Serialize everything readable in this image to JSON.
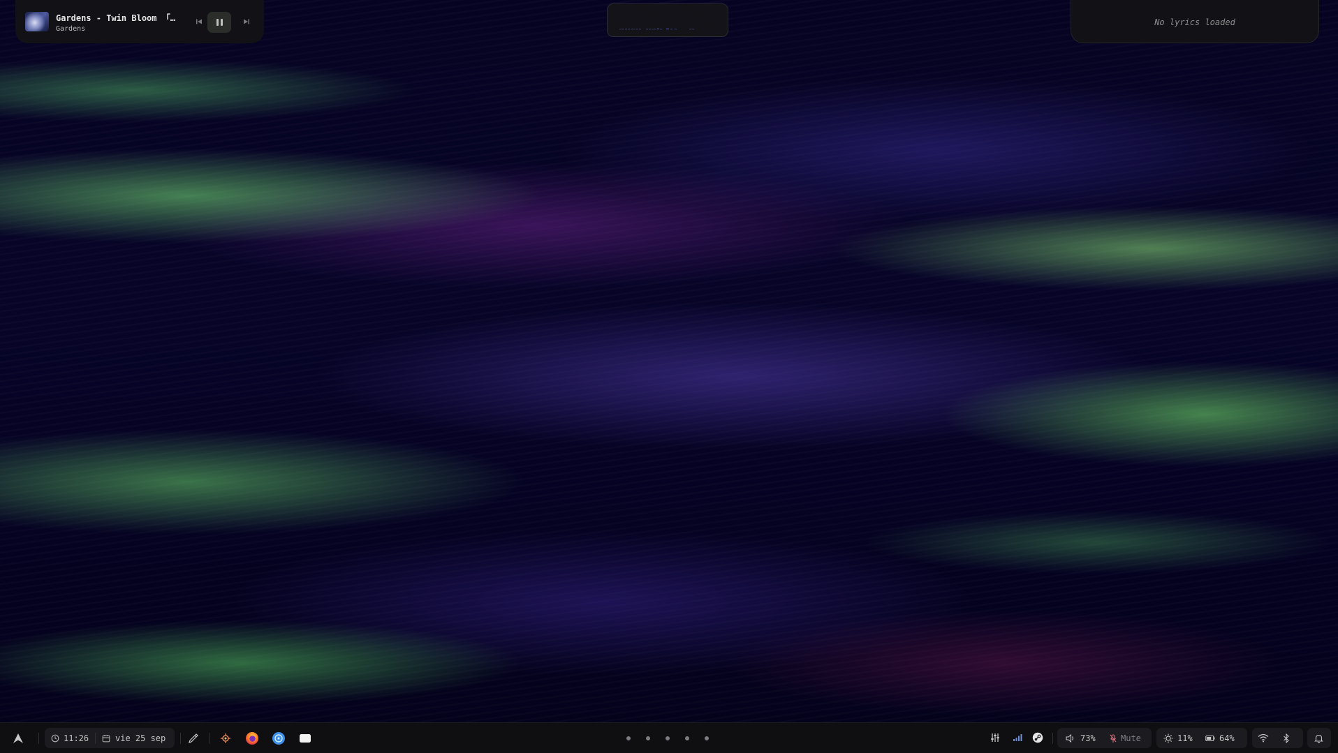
{
  "media_player": {
    "track_title": "Gardens - Twin Bloom 「…",
    "artist": "Gardens",
    "icons": {
      "album_art": "album-art",
      "previous": "skip-previous-icon",
      "pause": "pause-icon",
      "next": "skip-next-icon"
    }
  },
  "visualizer": {
    "icon": "audio-visualizer"
  },
  "lyrics": {
    "status": "No lyrics loaded"
  },
  "taskbar": {
    "launcher_icon": "arch-logo-icon",
    "clock": {
      "icon": "clock-icon",
      "time": "11:26"
    },
    "calendar": {
      "icon": "calendar-icon",
      "date": "vie 25 sep"
    },
    "color_picker_icon": "color-picker-icon",
    "pinned_apps": [
      {
        "name": "app-1",
        "icon": "gear-app-icon"
      },
      {
        "name": "firefox",
        "icon": "firefox-icon"
      },
      {
        "name": "app-3",
        "icon": "blue-circle-app-icon"
      },
      {
        "name": "app-4",
        "icon": "white-window-app-icon"
      }
    ],
    "workspaces": {
      "count": 5
    },
    "tray": {
      "mixer_icon": "equalizer-icon",
      "signal_icon": "signal-bars-icon",
      "steam_icon": "steam-icon"
    },
    "volume": {
      "icon": "speaker-icon",
      "value": "73%"
    },
    "microphone": {
      "icon": "mic-muted-icon",
      "label": "Mute"
    },
    "brightness": {
      "icon": "sun-icon",
      "value": "11%"
    },
    "battery": {
      "icon": "battery-icon",
      "value": "64%"
    },
    "network": {
      "wifi_icon": "wifi-icon",
      "bluetooth_icon": "bluetooth-icon"
    },
    "notifications_icon": "bell-icon"
  },
  "colors": {
    "panel_bg": "#121216",
    "bar_bg": "#0f0f12",
    "chip_bg": "#1c1c20",
    "text": "#c4c4c4",
    "muted_text": "#8d8d8d",
    "mic_muted": "#d36f7d",
    "firefox_orange": "#ff7a2a",
    "app_blue": "#3b8fe8"
  }
}
